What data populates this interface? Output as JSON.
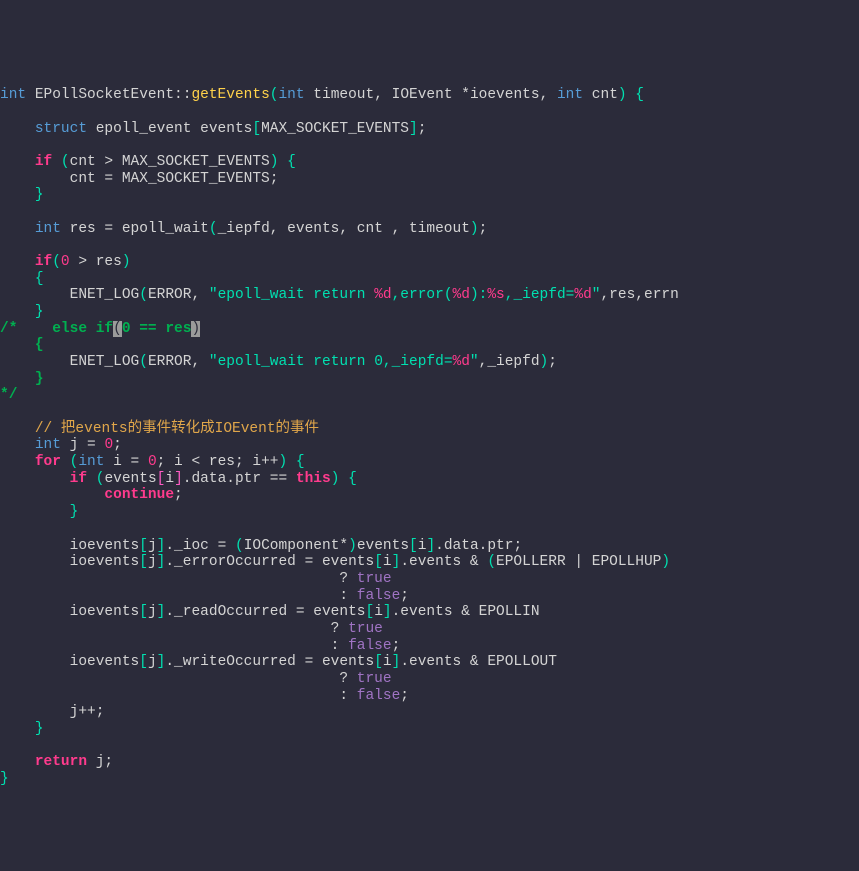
{
  "code": {
    "l1": {
      "int": "int ",
      "cls": "EPollSocketEvent",
      "sep": "::",
      "method": "getEvents",
      "sig1": "(",
      "p1t": "int ",
      "p1n": "timeout",
      "c1": ", ",
      "p2t": "IOEvent ",
      "p2n": "*ioevents",
      "c2": ", ",
      "p3t": "int ",
      "p3n": "cnt",
      "sig2": ")",
      "ob": " {"
    },
    "l3": {
      "struct": "struct ",
      "type": "epoll_event ",
      "name": "events",
      "lb": "[",
      "mac": "MAX_SOCKET_EVENTS",
      "rb": "]",
      "sc": ";"
    },
    "l5": {
      "if": "if ",
      "lp": "(",
      "a": "cnt > MAX_SOCKET_EVENTS",
      "rp": ")",
      "ob": " {"
    },
    "l6": {
      "body": "cnt = MAX_SOCKET_EVENTS;"
    },
    "l7": {
      "cb": "}"
    },
    "l9": {
      "int": "int ",
      "res": "res = ",
      "fn": "epoll_wait",
      "lp": "(",
      "args": "_iepfd, events, cnt , timeout",
      "rp": ")",
      "sc": ";"
    },
    "l11": {
      "if": "if",
      "lp": "(",
      "zero": "0",
      "gt": " > res",
      "rp": ")"
    },
    "l12": {
      "ob": "{"
    },
    "l13": {
      "fn": "ENET_LOG",
      "lp": "(",
      "err": "ERROR",
      "c1": ", ",
      "q1": "\"epoll_wait return ",
      "f1": "%d",
      "mid": ",error(",
      "f2": "%d",
      "mid2": "):",
      "f3": "%s",
      "mid3": ",_iepfd=",
      "f4": "%d",
      "q2": "\"",
      "args": ",res,errn"
    },
    "l14": {
      "cb": "}"
    },
    "l15": {
      "cm": "/*",
      "else": "    else if",
      "lp": "(",
      "zero": "0",
      "eq": " == res",
      "rp": ")"
    },
    "l16": {
      "ob": "{"
    },
    "l17": {
      "fn": "ENET_LOG",
      "lp": "(",
      "err": "ERROR",
      "c1": ", ",
      "q1": "\"epoll_wait return 0,_iepfd=",
      "f1": "%d",
      "q2": "\"",
      "args": ",_iepfd",
      "rp": ")",
      "sc": ";"
    },
    "l18": {
      "cb": "}"
    },
    "l19": {
      "cm": "*/"
    },
    "l21": {
      "c": "// 把events的事件转化成IOEvent的事件"
    },
    "l22": {
      "int": "int ",
      "body": "j = ",
      "zero": "0",
      "sc": ";"
    },
    "l23": {
      "for": "for ",
      "lp": "(",
      "int": "int ",
      "a": "i = ",
      "z": "0",
      "b": "; i < res; i++",
      "rp": ")",
      "ob": " {"
    },
    "l24": {
      "if": "if ",
      "lp": "(",
      "a": "events",
      "lb": "[",
      "i": "i",
      "rb": "]",
      "b": ".data.ptr == ",
      "this": "this",
      "rp": ")",
      "ob": " {"
    },
    "l25": {
      "cont": "continue",
      "sc": ";"
    },
    "l26": {
      "cb": "}"
    },
    "l28": {
      "a": "ioevents",
      "lb": "[",
      "j": "j",
      "rb": "]",
      "b": "._ioc = ",
      "lp": "(",
      "cast": "IOComponent*",
      "rp": ")",
      "c": "events",
      "lb2": "[",
      "i": "i",
      "rb2": "]",
      "d": ".data.ptr;"
    },
    "l29": {
      "a": "ioevents",
      "lb": "[",
      "j": "j",
      "rb": "]",
      "b": "._errorOccurred = events",
      "lb2": "[",
      "i": "i",
      "rb2": "]",
      "c": ".events & ",
      "lp": "(",
      "d": "EPOLLERR | EPOLLHUP",
      "rp": ")"
    },
    "l30": {
      "q": "? ",
      "t": "true"
    },
    "l31": {
      "q": ": ",
      "f": "false",
      "sc": ";"
    },
    "l32": {
      "a": "ioevents",
      "lb": "[",
      "j": "j",
      "rb": "]",
      "b": "._readOccurred = events",
      "lb2": "[",
      "i": "i",
      "rb2": "]",
      "c": ".events & EPOLLIN"
    },
    "l33": {
      "q": "? ",
      "t": "true"
    },
    "l34": {
      "q": ": ",
      "f": "false",
      "sc": ";"
    },
    "l35": {
      "a": "ioevents",
      "lb": "[",
      "j": "j",
      "rb": "]",
      "b": "._writeOccurred = events",
      "lb2": "[",
      "i": "i",
      "rb2": "]",
      "c": ".events & EPOLLOUT"
    },
    "l36": {
      "q": "? ",
      "t": "true"
    },
    "l37": {
      "q": ": ",
      "f": "false",
      "sc": ";"
    },
    "l38": {
      "body": "j++;"
    },
    "l39": {
      "cb": "}"
    },
    "l41": {
      "ret": "return ",
      "j": "j;"
    },
    "l42": {
      "cb": "}"
    }
  }
}
